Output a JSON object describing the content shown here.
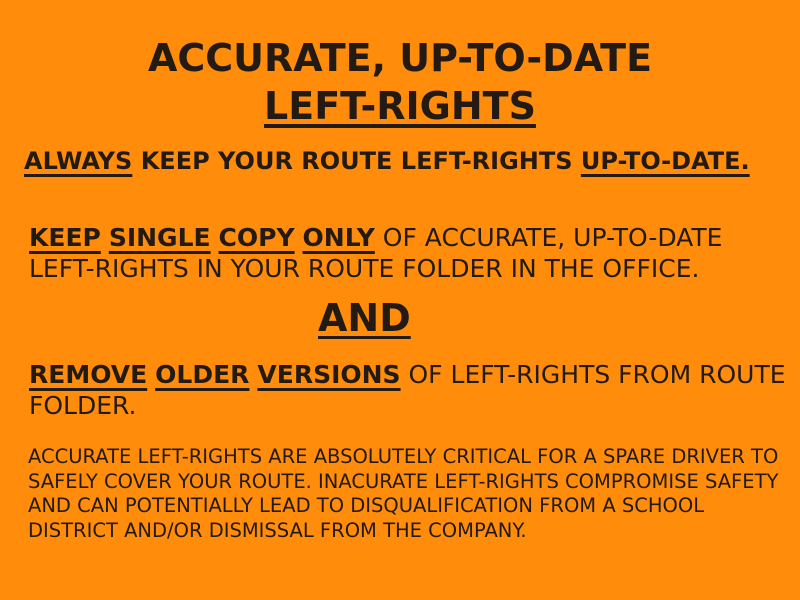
{
  "title": {
    "line1": "ACCURATE, UP-TO-DATE",
    "line2": " LEFT-RIGHTS"
  },
  "p1": {
    "u1": "ALWAYS",
    "t1": " KEEP YOUR ROUTE LEFT-RIGHTS ",
    "u2": "UP-TO-DATE."
  },
  "p2": {
    "u1": "KEEP",
    "u2": "SINGLE",
    "u3": "COPY",
    "u4": "ONLY",
    "t1": " OF ACCURATE, UP-TO-DATE LEFT-RIGHTS IN YOUR ROUTE FOLDER IN THE OFFICE."
  },
  "and": "AND",
  "p3": {
    "u1": "REMOVE",
    "u2": "OLDER",
    "u3": "VERSIONS",
    "t1": " OF LEFT-RIGHTS FROM ROUTE FOLDER."
  },
  "p4": "ACCURATE LEFT-RIGHTS ARE ABSOLUTELY CRITICAL FOR A SPARE DRIVER TO SAFELY COVER YOUR ROUTE. INACURATE LEFT-RIGHTS COMPROMISE SAFETY AND CAN POTENTIALLY LEAD TO DISQUALIFICATION FROM A SCHOOL DISTRICT AND/OR DISMISSAL FROM THE COMPANY.",
  "colors": {
    "background": "#FF8C0A",
    "text": "#231A14"
  }
}
